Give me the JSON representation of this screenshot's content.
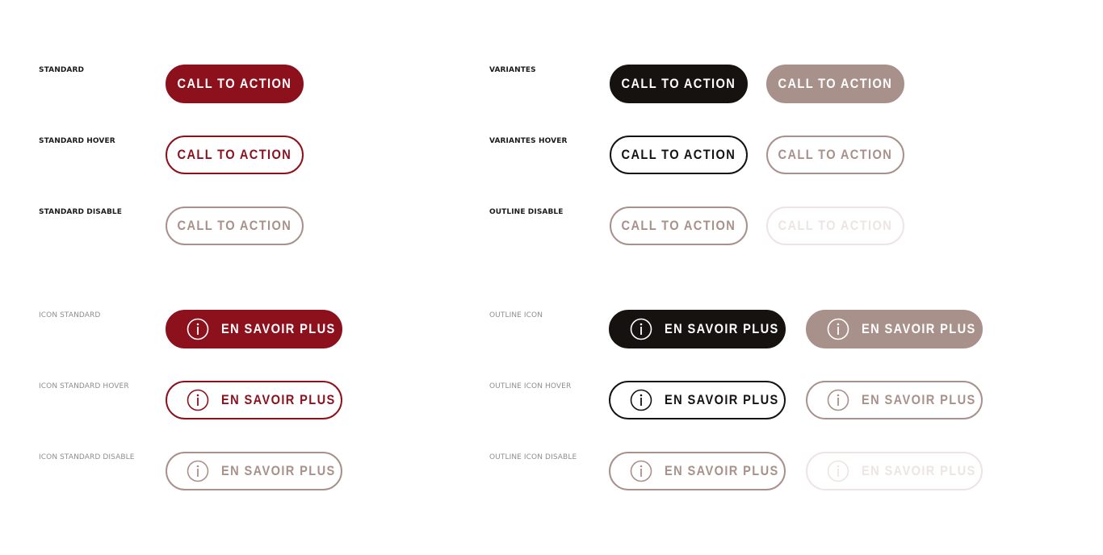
{
  "colors": {
    "brand_red": "#8c111d",
    "black": "#161210",
    "taupe": "#a9918b",
    "light": "#ece5e3"
  },
  "labels": {
    "standard": "STANDARD",
    "standard_hover": "STANDARD HOVER",
    "standard_disable": "STANDARD DISABLE",
    "variantes": "VARIANTES",
    "variantes_hover": "VARIANTES HOVER",
    "outline_disable": "OUTLINE DISABLE",
    "icon_standard": "ICON STANDARD",
    "icon_standard_hover": "ICON STANDARD HOVER",
    "icon_standard_disable": "ICON STANDARD DISABLE",
    "outline_icon": "OUTLINE ICON",
    "outline_icon_hover": "OUTLINE ICON HOVER",
    "outline_icon_disable": "OUTLINE ICON DISABLE"
  },
  "buttons": {
    "cta_label": "CALL TO ACTION",
    "info_label": "EN SAVOIR PLUS",
    "info_icon": "info-circle-icon"
  }
}
